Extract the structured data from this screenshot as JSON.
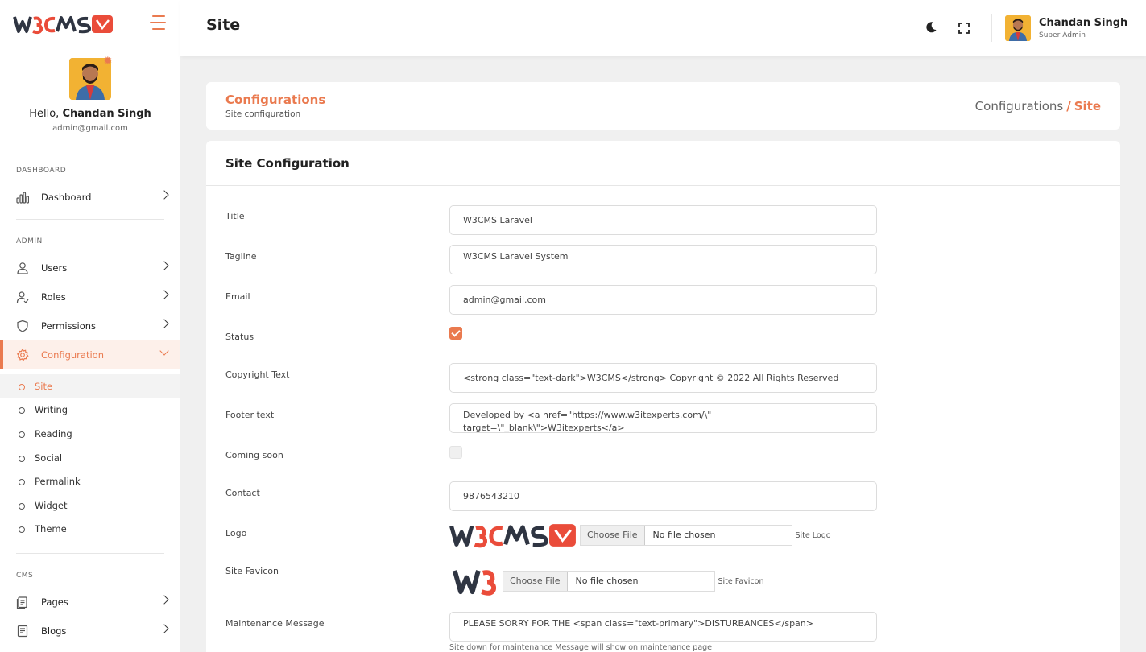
{
  "sidebar": {
    "brand": "W3CMS",
    "profile": {
      "greeting": "Hello,",
      "name": "Chandan Singh",
      "email": "admin@gmail.com"
    },
    "sections": {
      "dashboard": "DASHBOARD",
      "admin": "ADMIN",
      "cms": "CMS"
    },
    "items": {
      "dashboard": "Dashboard",
      "users": "Users",
      "roles": "Roles",
      "permissions": "Permissions",
      "configuration": "Configuration",
      "pages": "Pages",
      "blogs": "Blogs"
    },
    "config_sub": [
      "Site",
      "Writing",
      "Reading",
      "Social",
      "Permalink",
      "Widget",
      "Theme"
    ]
  },
  "header": {
    "title": "Site",
    "user": {
      "name": "Chandan Singh",
      "role": "Super Admin"
    }
  },
  "breadcrumb": {
    "title": "Configurations",
    "subtitle": "Site configuration",
    "trail": [
      "Configurations",
      "Site"
    ],
    "separator": "/"
  },
  "form": {
    "heading": "Site Configuration",
    "fields": {
      "title": {
        "label": "Title",
        "value": "W3CMS Laravel"
      },
      "tagline": {
        "label": "Tagline",
        "value": "W3CMS Laravel System"
      },
      "email": {
        "label": "Email",
        "value": "admin@gmail.com"
      },
      "status": {
        "label": "Status",
        "checked": true
      },
      "copyright": {
        "label": "Copyright Text",
        "value": "<strong class=\"text-dark\">W3CMS</strong> Copyright © 2022 All Rights Reserved"
      },
      "footer": {
        "label": "Footer text",
        "value": "Developed by <a href=\"https://www.w3itexperts.com/\\\" target=\\\"_blank\\\">W3itexperts</a>"
      },
      "coming_soon": {
        "label": "Coming soon",
        "checked": false
      },
      "contact": {
        "label": "Contact",
        "value": "9876543210"
      },
      "logo": {
        "label": "Logo",
        "button": "Choose File",
        "file": "No file chosen",
        "hint": "Site Logo"
      },
      "favicon": {
        "label": "Site Favicon",
        "button": "Choose File",
        "file": "No file chosen",
        "hint": "Site Favicon"
      },
      "maintenance": {
        "label": "Maintenance Message",
        "value": "PLEASE SORRY FOR THE <span class=\"text-primary\">DISTURBANCES</span>",
        "help": "Site down for maintenance Message will show on maintenance page"
      }
    }
  },
  "colors": {
    "accent": "#ea7a4f",
    "brand_dark": "#2f3542"
  },
  "icons": [
    "hamburger-icon",
    "gear-icon",
    "chart-icon",
    "user-icon",
    "users-icon",
    "shield-icon",
    "settings-icon",
    "page-icon",
    "blog-icon",
    "moon-icon",
    "expand-icon",
    "chevron-right-icon"
  ]
}
